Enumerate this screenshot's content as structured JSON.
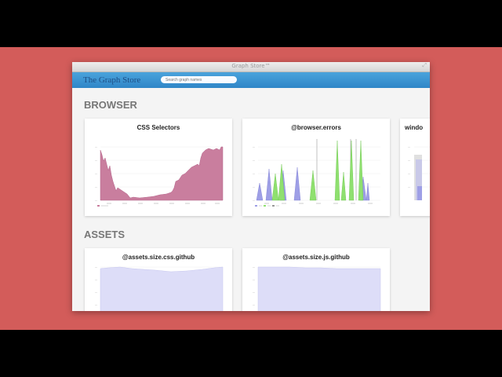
{
  "window": {
    "title": "Graph Store™"
  },
  "app": {
    "brand": "The Graph Store",
    "search_placeholder": "Search graph names"
  },
  "sections": [
    {
      "title": "BROWSER"
    },
    {
      "title": "ASSETS"
    }
  ],
  "cards": [
    {
      "title": "CSS Selectors"
    },
    {
      "title": "@browser.errors"
    },
    {
      "title": "windo"
    },
    {
      "title": "@assets.size.css.github"
    },
    {
      "title": "@assets.size.js.github"
    }
  ],
  "colors": {
    "background_band": "#d35c5a",
    "appbar": "#3b94d3",
    "css_selectors_area": "#c97e9e",
    "errors_blue": "#9e9fe6",
    "errors_green": "#8fe06f",
    "assets_area": "#ddddf8"
  }
}
